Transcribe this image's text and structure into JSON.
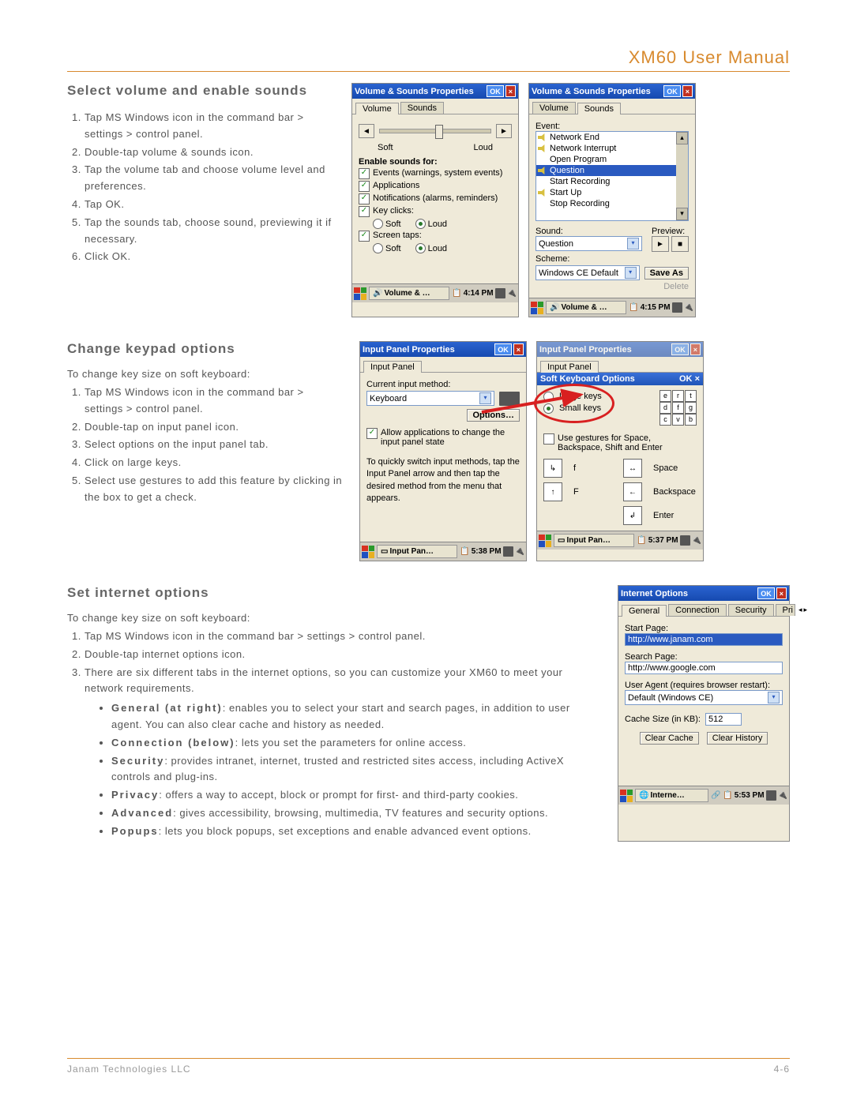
{
  "doc": {
    "title": "XM60 User Manual",
    "footer_left": "Janam Technologies LLC",
    "footer_right": "4-6"
  },
  "sec1": {
    "title": "Select volume and enable sounds",
    "steps": [
      "Tap MS Windows icon in the command bar > settings > control panel.",
      "Double-tap volume & sounds icon.",
      "Tap the volume tab and choose volume level and preferences.",
      "Tap OK.",
      "Tap the sounds tab, choose sound, previewing it if necessary.",
      "Click OK."
    ]
  },
  "vol1": {
    "title": "Volume & Sounds Properties",
    "ok": "OK",
    "x": "×",
    "tab_volume": "Volume",
    "tab_sounds": "Sounds",
    "left_icon": "◄",
    "right_icon": "►",
    "soft": "Soft",
    "loud": "Loud",
    "enable": "Enable sounds for:",
    "chk_events": "Events (warnings, system events)",
    "chk_apps": "Applications",
    "chk_notif": "Notifications (alarms, reminders)",
    "chk_keys": "Key clicks:",
    "chk_screen": "Screen taps:",
    "r_soft": "Soft",
    "r_loud": "Loud",
    "task": "Volume & …",
    "time": "4:14 PM"
  },
  "vol2": {
    "title": "Volume & Sounds Properties",
    "ok": "OK",
    "x": "×",
    "tab_volume": "Volume",
    "tab_sounds": "Sounds",
    "event": "Event:",
    "items": [
      "Network End",
      "Network Interrupt",
      "Open Program",
      "Question",
      "Start Recording",
      "Start Up",
      "Stop Recording"
    ],
    "sound": "Sound:",
    "preview": "Preview:",
    "sound_val": "Question",
    "play": "►",
    "stop": "■",
    "scheme": "Scheme:",
    "scheme_val": "Windows CE Default",
    "saveas": "Save As",
    "delete": "Delete",
    "task": "Volume & …",
    "time": "4:15 PM"
  },
  "sec2": {
    "title": "Change keypad options",
    "intro": "To change key size on soft keyboard:",
    "steps": [
      "Tap MS Windows icon in the command bar > settings > control panel.",
      "Double-tap on input panel icon.",
      "Select options on the input panel tab.",
      "Click on large keys.",
      "Select use gestures to add this feature by clicking in the box to get a check."
    ]
  },
  "ipp": {
    "title": "Input Panel Properties",
    "ok": "OK",
    "x": "×",
    "tab": "Input Panel",
    "cur": "Current input method:",
    "method": "Keyboard",
    "options": "Options…",
    "allow": "Allow applications to change the input panel state",
    "tip": "To quickly switch input methods, tap the Input Panel arrow and then tap the desired method from the menu that appears.",
    "task": "Input Pan…",
    "time": "5:38 PM"
  },
  "sko": {
    "title": "Input Panel Properties",
    "ok": "OK",
    "x": "×",
    "tab": "Input Panel",
    "dlg_title": "Soft Keyboard Options",
    "dlg_ok": "OK",
    "dlg_x": "×",
    "large": "Large keys",
    "small": "Small keys",
    "gest": "Use gestures for Space, Backspace, Shift and Enter",
    "g_space": "Space",
    "g_back": "Backspace",
    "g_enter": "Enter",
    "g_f": "f",
    "g_F": "F",
    "task": "Input Pan…",
    "time": "5:37 PM"
  },
  "sec3": {
    "title": "Set internet options",
    "intro": "To change key size on soft keyboard:",
    "steps": [
      "Tap MS Windows icon in the command bar > settings > control panel.",
      "Double-tap internet options icon.",
      "There are six different tabs in the internet options, so you can customize your XM60 to meet your network requirements."
    ],
    "bullets": [
      {
        "h": "General (at right)",
        "t": ": enables you to select your start and search pages, in addition to user agent. You can also clear cache and history as needed."
      },
      {
        "h": "Connection (below)",
        "t": ": lets you set the parameters for online access."
      },
      {
        "h": "Security",
        "t": ": provides intranet, internet, trusted and restricted sites access, including ActiveX controls and plug-ins."
      },
      {
        "h": "Privacy",
        "t": ": offers a way to accept, block or prompt for first- and third-party cookies."
      },
      {
        "h": "Advanced",
        "t": ": gives accessibility, browsing, multimedia, TV features and security options."
      },
      {
        "h": "Popups",
        "t": ": lets you block popups, set exceptions and enable advanced event options."
      }
    ]
  },
  "io": {
    "title": "Internet Options",
    "ok": "OK",
    "x": "×",
    "tabs": [
      "General",
      "Connection",
      "Security",
      "Pri"
    ],
    "start": "Start Page:",
    "start_val": "http://www.janam.com",
    "search": "Search Page:",
    "search_val": "http://www.google.com",
    "ua": "User Agent (requires browser restart):",
    "ua_val": "Default (Windows CE)",
    "cache": "Cache Size (in KB):",
    "cache_val": "512",
    "clear_cache": "Clear Cache",
    "clear_hist": "Clear History",
    "task": "Interne…",
    "time": "5:53 PM"
  }
}
